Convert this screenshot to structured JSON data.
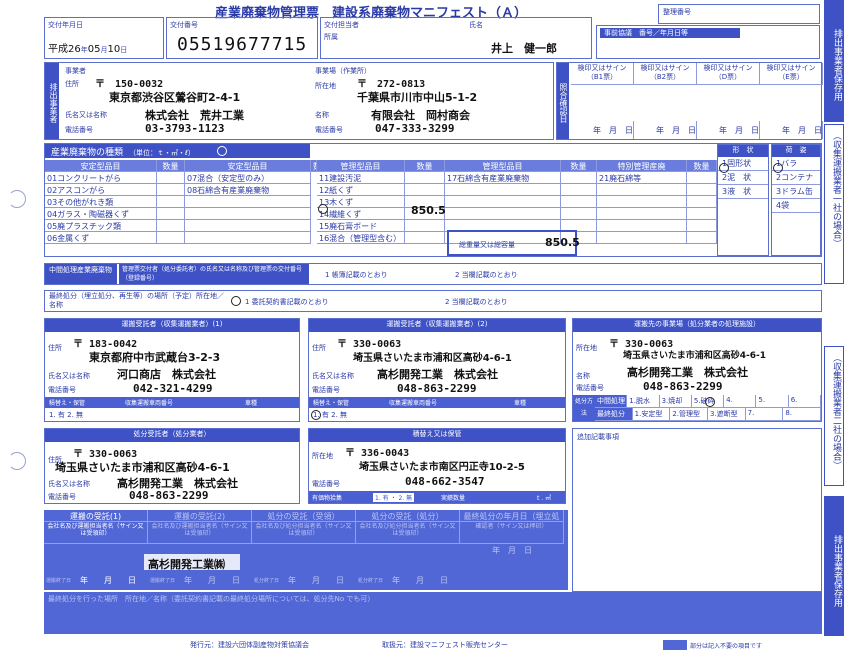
{
  "title": "産業廃棄物管理票　建設系廃棄物マニフェスト（Ａ）",
  "seiri_label": "整理番号",
  "issue_date": {
    "label": "交付年月日",
    "era": "平成26",
    "y": "年",
    "month": "05",
    "m": "月",
    "day": "10",
    "d": "日"
  },
  "issue_no": {
    "label": "交付番号",
    "value": "05519677715"
  },
  "tantou": {
    "label": "交付担当者",
    "sub": "所属",
    "name_label": "氏名",
    "name": "井上　健一郎"
  },
  "jizen": "事前協議　番号／年月日等",
  "side": {
    "top": "排出事業者保存用",
    "mid": "（収集運搬業者一社の場合）",
    "mid2": "（収集運搬業者二社の場合）",
    "bottom": "排出事業者保存用"
  },
  "haishutsu": {
    "tag": "排出事業者",
    "jigyousha": "事業者",
    "addr_label": "住所",
    "zip": "〒　150-0032",
    "addr": "東京都渋谷区鶯谷町2-4-1",
    "name_label": "氏名又は名称",
    "name": "株式会社　荒井工業",
    "tel_label": "電話番号",
    "tel": "03-3793-1123"
  },
  "site": {
    "label": "事業場（作業所）",
    "addr_label": "所在地",
    "zip": "〒　272-0813",
    "addr": "千葉県市川市中山5-1-2",
    "name_label": "名称",
    "name": "有限会社　岡村商会",
    "tel_label": "電話番号",
    "tel": "047-333-3299"
  },
  "shoukai": {
    "tag": "照合確認日",
    "cols": [
      "検印又はサイン（B1票）",
      "検印又はサイン（B2票）",
      "検印又はサイン（D票）",
      "検印又はサイン（E票）"
    ],
    "ymd": [
      "年",
      "月",
      "日"
    ]
  },
  "types": {
    "header": "産業廃棄物の種類",
    "unit": "（単位：ｔ・㎥・ℓ）",
    "cols": [
      "安定型品目",
      "数量",
      "安定型品目",
      "数量",
      "管理型品目",
      "数量",
      "管理型品目",
      "数量",
      "特別管理産廃",
      "数量"
    ],
    "c1": [
      "01コンクリートがら",
      "02アスコンがら",
      "03その他がれき類",
      "04ガラス・陶磁器くず",
      "05廃プラスチック類",
      "06金属くず"
    ],
    "c2": [
      "07混合（安定型のみ）",
      "08石綿含有産業廃棄物"
    ],
    "c3": [
      "11建設汚泥",
      "12紙くず",
      "13木くず",
      "14繊維くず",
      "15廃石膏ボード",
      "16混合（管理型含む）"
    ],
    "c3_qty": "850.5",
    "c4": [
      "17石綿含有産業廃棄物"
    ],
    "c5": [
      "21廃石綿等"
    ],
    "total_label": "総重量又は総容量",
    "total": "850.5",
    "form_header": "形　状",
    "forms": [
      "1固形状",
      "2泥　状",
      "3液　状"
    ],
    "pack_header": "荷　姿",
    "packs": [
      "1バラ",
      "2コンテナ",
      "3ドラム缶",
      "4袋"
    ]
  },
  "chukan": {
    "label": "中間処理産業廃棄物",
    "desc": "管理票交付者（処分委託者）の氏名又は名称及び管理票の交付番号（登録番号）",
    "o1": "1 帳簿記載のとおり",
    "o2": "2 当欄記載のとおり"
  },
  "final": {
    "label": "最終処分（埋立処分、再生等）の場所（予定）所在地／名称",
    "o1": "1 委託契約書記載のとおり",
    "o2": "2 当欄記載のとおり"
  },
  "un1": {
    "header": "運搬受託者（収集運搬業者）(1)",
    "addr_label": "住所",
    "zip": "〒 183-0042",
    "addr": "東京都府中市武蔵台3-2-3",
    "name_label": "氏名又は名称",
    "name": "河口商店　株式会社",
    "tel_label": "電話番号",
    "tel": "042-321-4299",
    "h1": "積替え・保管",
    "h2": "収集運搬車両番号",
    "h3": "車種",
    "opt": "1. 有  2. 無"
  },
  "un2": {
    "header": "運搬受託者（収集運搬業者）(2)",
    "addr_label": "住所",
    "zip": "〒 330-0063",
    "addr": "埼玉県さいたま市浦和区高砂4-6-1",
    "name_label": "氏名又は名称",
    "name": "高杉開発工業　株式会社",
    "tel_label": "電話番号",
    "tel": "048-863-2299",
    "h1": "積替え・保管",
    "h2": "収集運搬車両番号",
    "h3": "車種",
    "opt": "1. 有  2. 無"
  },
  "dest": {
    "header": "運搬先の事業場（処分業者の処理施設）",
    "addr_label": "所在地",
    "zip": "〒 330-0063",
    "addr": "埼玉県さいたま市浦和区高砂4-6-1",
    "name_label": "名称",
    "name": "高杉開発工業　株式会社",
    "tel_label": "電話番号",
    "tel": "048-863-2299",
    "m1": "処分方法",
    "r1": [
      "中間処理",
      "1.脱水",
      "3.焼却",
      "5.破砕",
      "4.",
      "5.",
      "6."
    ],
    "r2": [
      "最終処分",
      "1.安定型",
      "2.管理型",
      "3.遮断型",
      "7.",
      "8."
    ]
  },
  "shobun": {
    "header": "処分受託者（処分業者）",
    "addr_label": "住所",
    "zip": "〒 330-0063",
    "addr": "埼玉県さいたま市浦和区高砂4-6-1",
    "name_label": "氏名又は名称",
    "name": "高杉開発工業　株式会社",
    "tel_label": "電話番号",
    "tel": "048-863-2299"
  },
  "tsumikae": {
    "header": "積替え又は保管",
    "addr_label": "所在地",
    "zip": "〒 336-0043",
    "addr": "埼玉県さいたま市南区円正寺10-2-5",
    "tel_label": "電話番号",
    "tel": "048-662-3547",
    "v_label": "有価物拾集",
    "opt": "1. 有 ・ 2. 無",
    "qty_label": "実績数量",
    "qty_unit": "t . ㎥"
  },
  "tsuiki": "追加記載事項",
  "recv": {
    "r1": "運搬の受託(1)",
    "r1s": "会社名及び運搬担当者名（サイン又は受領印）",
    "r2": "運搬の受託(2)",
    "r2s": "会社名及び運搬担当者名（サイン又は受領印）",
    "r3": "処分の受託（受領）",
    "r3s": "会社名及び処分担当者名（サイン又は受領印）",
    "r4": "処分の受託（処分）",
    "r4s": "会社名及び処分担当者名（サイン又は受領印）",
    "r5": "最終処分の年月日（埋立処分、再生等）",
    "r5d": "年　月　日",
    "r5s": "確認者（サイン又は押印）",
    "stamp": "高杉開発工業㈱",
    "ymd": "年　　月　　日",
    "dl": "運搬終了日",
    "dl2": "処分終了日"
  },
  "final_place": "最終処分を行った場所　所在地／名称（委託契約書記載の最終処分場所については、処分先No でも可）",
  "footer": {
    "issuer": "発行元：建設六団体副産物対策協議会",
    "seller": "取扱元：建設マニフェスト販売センター",
    "legend": "部分は記入不要の項目です"
  }
}
